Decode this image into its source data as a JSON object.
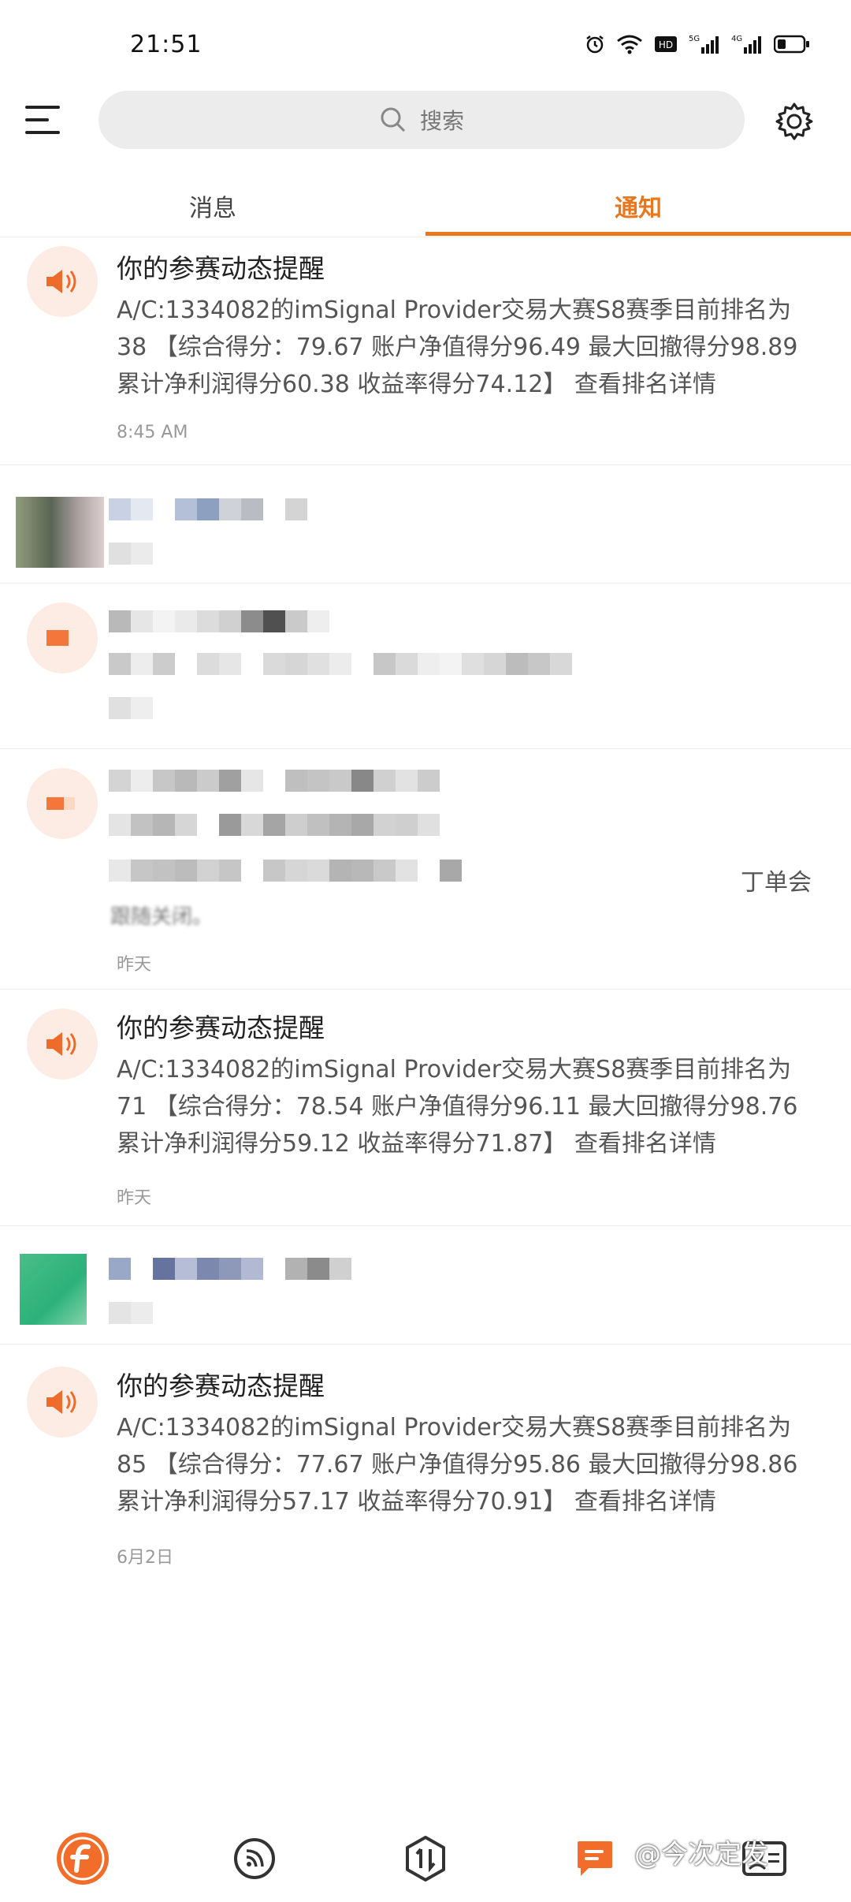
{
  "status_bar": {
    "time": "21:51",
    "icons": [
      "alarm-icon",
      "wifi-icon",
      "hd-icon",
      "signal-5g-icon",
      "signal-4g-icon",
      "battery-icon"
    ]
  },
  "top_bar": {
    "search_placeholder": "搜索",
    "icons": [
      "menu-icon",
      "search-icon",
      "settings-icon"
    ]
  },
  "tabs": [
    {
      "label": "消息",
      "active": false
    },
    {
      "label": "通知",
      "active": true
    }
  ],
  "accent_color": "#e8771e",
  "notices": [
    {
      "title": "你的参赛动态提醒",
      "body_lines": [
        "A/C:1334082的imSignal Provider交易大赛S8赛季目前排名为",
        "38 【综合得分：79.67 账户净值得分96.49 最大回撤得分98.89",
        "累计净利润得分60.38 收益率得分74.12】 查看排名详情"
      ],
      "time": "8:45 AM"
    },
    {
      "title": "你的参赛动态提醒",
      "body_lines": [
        "A/C:1334082的imSignal Provider交易大赛S8赛季目前排名为",
        "71 【综合得分：78.54 账户净值得分96.11 最大回撤得分98.76",
        "累计净利润得分59.12 收益率得分71.87】 查看排名详情"
      ],
      "time": "昨天"
    },
    {
      "title": "你的参赛动态提醒",
      "body_lines": [
        "A/C:1334082的imSignal Provider交易大赛S8赛季目前排名为",
        "85 【综合得分：77.67 账户净值得分95.86 最大回撤得分98.86",
        "累计净利润得分57.17 收益率得分70.91】 查看排名详情"
      ],
      "time": "6月2日"
    }
  ],
  "blurred_items": {
    "item4_fragment": "丁单会",
    "item4_line": "跟随关闭。",
    "item4_time": "昨天"
  },
  "bottom_nav": {
    "items": [
      "fxtm-logo-icon",
      "feed-icon",
      "trade-icon",
      "chat-icon",
      "contact-card-icon"
    ],
    "watermark": "@今次定发"
  }
}
